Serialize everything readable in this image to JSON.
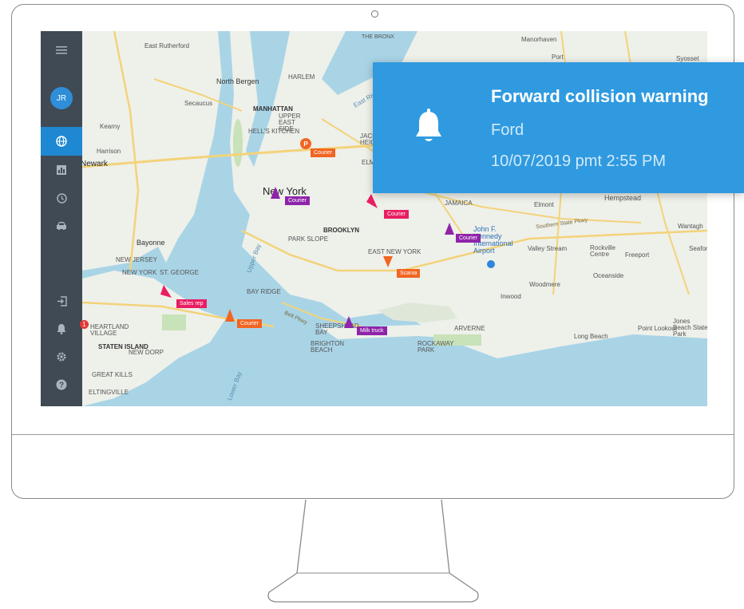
{
  "sidebar": {
    "avatar_initials": "JR",
    "notification_count": "1",
    "items": [
      {
        "name": "menu-icon"
      },
      {
        "name": "globe-icon",
        "active": true
      },
      {
        "name": "bar-chart-icon"
      },
      {
        "name": "clock-icon"
      },
      {
        "name": "car-icon"
      },
      {
        "name": "logout-icon"
      },
      {
        "name": "bell-icon"
      },
      {
        "name": "gear-icon"
      },
      {
        "name": "help-icon"
      }
    ]
  },
  "map": {
    "places": {
      "east_rutherford": "East Rutherford",
      "north_bergen": "North Bergen",
      "secaucus": "Secaucus",
      "kearny": "Kearny",
      "harrison": "Harrison",
      "newark": "Newark",
      "manhattan": "MANHATTAN",
      "upper_east_side": "UPPER EAST SIDE",
      "harlem": "HARLEM",
      "hells_kitchen": "HELL'S KITCHEN",
      "jackson_heights": "JACKSON HEIGHTS",
      "elmhurst": "ELMHURST",
      "new_york": "New York",
      "brooklyn": "BROOKLYN",
      "park_slope": "PARK SLOPE",
      "east_new_york": "EAST NEW YORK",
      "bayonne": "Bayonne",
      "new_jersey": "NEW JERSEY",
      "st_george": "ST. GEORGE",
      "new_york_small": "NEW YORK",
      "bay_ridge": "BAY RIDGE",
      "heartland_village": "HEARTLAND VILLAGE",
      "staten_island": "STATEN ISLAND",
      "new_dorp": "NEW DORP",
      "great_kills": "GREAT KILLS",
      "eltingville": "ELTINGVILLE",
      "sheepshead_bay": "SHEEPSHEAD BAY",
      "brighton_beach": "BRIGHTON BEACH",
      "rockaway_park": "ROCKAWAY PARK",
      "arverne": "ARVERNE",
      "jamaica": "JAMAICA",
      "jfk_airport": "John F. Kennedy International Airport",
      "valley_stream": "Valley Stream",
      "rockville_centre": "Rockville Centre",
      "freeport": "Freeport",
      "oceanside": "Oceanside",
      "woodmere": "Woodmere",
      "inwood": "Inwood",
      "long_beach": "Long Beach",
      "point_lookout": "Point Lookout",
      "jones_beach": "Jones Beach State Park",
      "elmont": "Elmont",
      "hempstead": "Hempstead",
      "wantagh": "Wantagh",
      "seaford": "Seaford",
      "manorhaven": "Manorhaven",
      "port": "Port",
      "syosset": "Syosset",
      "the_bronx": "THE BRONX",
      "upper_bay": "Upper Bay",
      "lower_bay": "Lower Bay",
      "east_river": "East River",
      "southern_state": "Southern State Pkwy",
      "belt_pkwy": "Belt Pkwy"
    },
    "vehicles": [
      {
        "label": "Courier",
        "color": "#f26522"
      },
      {
        "label": "Courier",
        "color": "#8e24aa"
      },
      {
        "label": "Courier",
        "color": "#e91e63"
      },
      {
        "label": "Courier",
        "color": "#8e24aa"
      },
      {
        "label": "Scania",
        "color": "#f26522"
      },
      {
        "label": "Sales rep",
        "color": "#e91e63"
      },
      {
        "label": "Courier",
        "color": "#f26522"
      },
      {
        "label": "Milk truck",
        "color": "#8e24aa"
      }
    ],
    "parking_letter": "P"
  },
  "notification": {
    "title": "Forward collision warning",
    "vehicle": "Ford",
    "time": "10/07/2019 pmt 2:55 PM"
  },
  "colors": {
    "sidebar": "#3f4a55",
    "active": "#1e88d2",
    "notification": "#2f9ae0",
    "water": "#a9d4e6",
    "land": "#eef0ea"
  }
}
